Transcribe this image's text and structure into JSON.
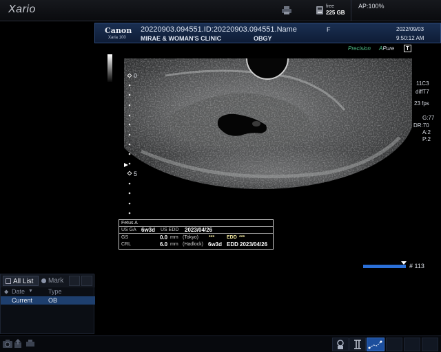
{
  "app": {
    "title": "Xario"
  },
  "status": {
    "disk_free_label": "free",
    "disk_free_size": "225 GB",
    "ap": "AP:100%"
  },
  "patient": {
    "brand": "Canon",
    "model": "Xaria 100",
    "id_line": "20220903.094551.ID:20220903.094551.Name",
    "sex": "F",
    "date": "2022/09/03",
    "time": "9:50:12 AM",
    "institution": "MIRAE & WOMAN'S CLINIC",
    "department": "OBGY"
  },
  "modes": {
    "precision": "Precision",
    "apure_a": "A",
    "apure_rest": "Pure",
    "t_box": "T"
  },
  "image_params": [
    "11C3",
    "diffT7",
    "23 fps",
    "G:77",
    "DR:70",
    "A:2",
    "P:2"
  ],
  "depth_scale": {
    "top": "0",
    "mid": "5"
  },
  "measurement": {
    "title": "Fetus A",
    "usga_label": "US GA",
    "usga_value": "6w3d",
    "usedd_label": "US EDD",
    "usedd_value": "2023/04/26",
    "rows": [
      {
        "name": "GS",
        "value": "0.0",
        "unit": "mm",
        "method": "(Tokyo)",
        "ga": "***",
        "edd_label": "EDD",
        "edd": "***"
      },
      {
        "name": "CRL",
        "value": "6.0",
        "unit": "mm",
        "method": "(Hadlock)",
        "ga": "6w3d",
        "edd_label": "EDD",
        "edd": "2023/04/26"
      }
    ]
  },
  "frame": {
    "label": "# 113",
    "position_fraction": 0.95
  },
  "study_list": {
    "tabs": [
      "All List",
      "Mark"
    ],
    "columns": [
      "Date",
      "Type"
    ],
    "rows": [
      {
        "date": "Current",
        "type": "OB"
      }
    ]
  },
  "colors": {
    "accent": "#2b70d8",
    "header_bg": "#1a2f52",
    "selected_row": "#1e3f6e",
    "precision_green": "#4fc28a"
  }
}
